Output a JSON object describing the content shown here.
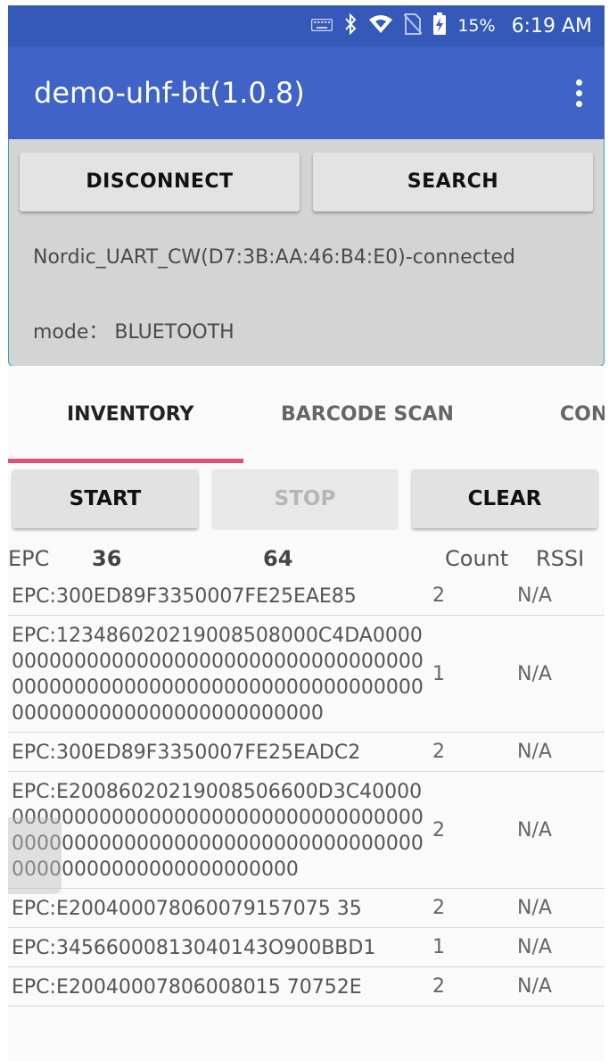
{
  "status_bar": {
    "battery": "15%",
    "time": "6:19 AM",
    "icons": [
      "keyboard-icon",
      "bluetooth-icon",
      "wifi-icon",
      "no-sim-icon",
      "battery-charging-icon"
    ]
  },
  "app_bar": {
    "title": "demo-uhf-bt(1.0.8)",
    "menu_icon": "overflow-menu-icon"
  },
  "connection": {
    "disconnect_label": "DISCONNECT",
    "search_label": "SEARCH",
    "status": "Nordic_UART_CW(D7:3B:AA:46:B4:E0)-connected",
    "mode": "mode： BLUETOOTH"
  },
  "tabs": [
    {
      "label": "INVENTORY",
      "active": true
    },
    {
      "label": "BARCODE SCAN",
      "active": false
    },
    {
      "label": "CON",
      "active": false
    }
  ],
  "actions": {
    "start_label": "START",
    "stop_label": "STOP",
    "clear_label": "CLEAR"
  },
  "table": {
    "header": {
      "epc": "EPC",
      "unique_count": "36",
      "total_count": "64",
      "count": "Count",
      "rssi": "RSSI"
    },
    "rows": [
      {
        "epc": "EPC:300ED89F3350007FE25EAE85",
        "count": "2",
        "rssi": "N/A"
      },
      {
        "epc": "EPC:123486020219008508000C4DA00000000000000000000000000000000000000000000000000000000000000000000000000000000000000000000000",
        "count": "1",
        "rssi": "N/A"
      },
      {
        "epc": "EPC:300ED89F3350007FE25EADC2",
        "count": "2",
        "rssi": "N/A"
      },
      {
        "epc": "EPC:E20086020219008506600D3C4000000000000000000000000000000000000000000000000000000000000000000000000000000000000000000000",
        "count": "2",
        "rssi": "N/A"
      },
      {
        "epc": "EPC:E200400078060079157075 35",
        "count": "2",
        "rssi": "N/A"
      },
      {
        "epc": "EPC:34566000813040143O900BBD1",
        "count": "1",
        "rssi": "N/A"
      },
      {
        "epc": "EPC:E20040007806008015 70752E",
        "count": "2",
        "rssi": "N/A"
      }
    ]
  },
  "colors": {
    "status_bar": "#3459b8",
    "app_bar": "#3f63c6",
    "tab_indicator": "#e0507a",
    "panel_border": "#2f9fd0"
  }
}
